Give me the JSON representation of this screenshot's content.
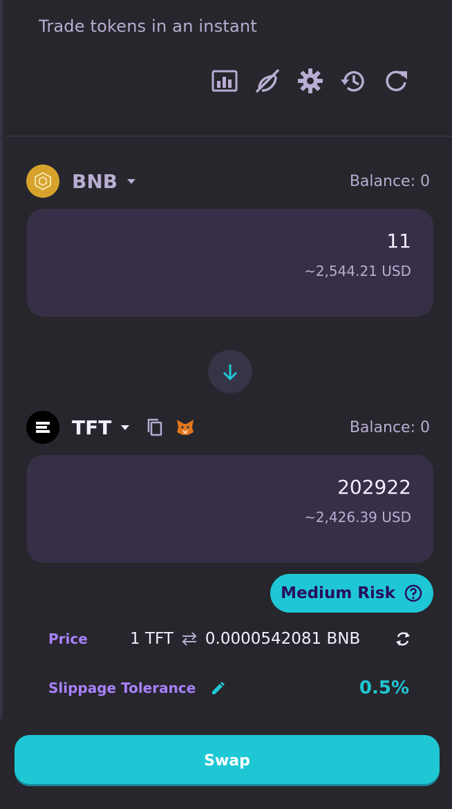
{
  "header": {
    "subtitle": "Trade tokens in an instant",
    "tools": [
      {
        "icon": "chart-icon"
      },
      {
        "icon": "chart-disabled-icon"
      },
      {
        "icon": "gear-icon"
      },
      {
        "icon": "history-icon"
      },
      {
        "icon": "refresh-icon"
      }
    ]
  },
  "from": {
    "symbol": "BNB",
    "balance": "Balance: 0",
    "amount": "11",
    "usd": "~2,544.21 USD",
    "logo_color": "#d6a22c"
  },
  "to": {
    "symbol": "TFT",
    "balance": "Balance: 0",
    "amount": "202922",
    "usd": "~2,426.39 USD"
  },
  "risk": {
    "label": "Medium Risk"
  },
  "price": {
    "label": "Price",
    "left": "1 TFT",
    "right": "0.0000542081 BNB"
  },
  "slippage": {
    "label": "Slippage Tolerance",
    "value": "0.5%"
  },
  "swap": {
    "label": "Swap"
  },
  "colors": {
    "accent": "#1fc7d4",
    "secondary": "#a881fc",
    "box": "#372f47",
    "text_muted": "#b8add2"
  }
}
